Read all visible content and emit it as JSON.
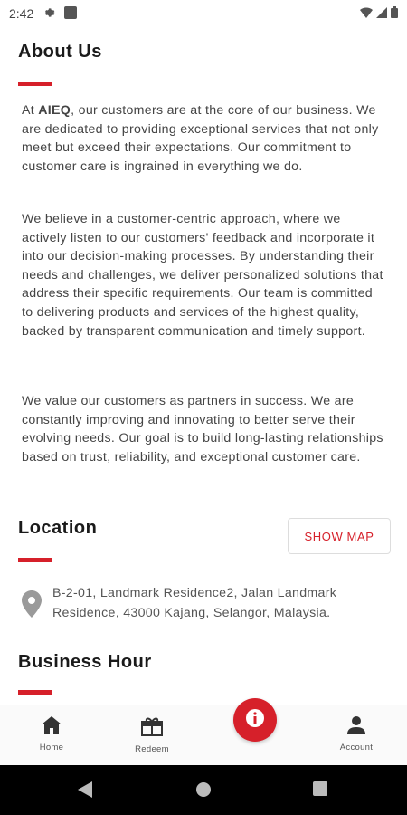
{
  "status_bar": {
    "time": "2:42"
  },
  "about": {
    "title": "About Us",
    "p1_prefix": "At ",
    "p1_brand": "AIEQ",
    "p1_rest": ", our customers are at the core of our business. We are dedicated to providing exceptional services that not only meet but exceed their expectations. Our commitment to customer care is ingrained in everything we do.",
    "p2": "We believe in a customer-centric approach, where we actively listen to our customers' feedback and incorporate it into our decision-making processes. By understanding their needs and challenges, we deliver personalized solutions that address their specific requirements. Our team is committed to delivering products and services of the highest quality, backed by transparent communication and timely support.",
    "p3": "We value our customers as partners in success. We are constantly improving and innovating to better serve their evolving needs. Our goal is to build long-lasting relationships based on trust, reliability, and exceptional customer care."
  },
  "location": {
    "title": "Location",
    "show_map_label": "SHOW MAP",
    "address": "B-2-01, Landmark Residence2, Jalan Landmark Residence, 43000 Kajang, Selangor, Malaysia."
  },
  "business_hour": {
    "title": "Business Hour"
  },
  "bottom_nav": {
    "home_label": "Home",
    "redeem_label": "Redeem",
    "account_label": "Account"
  },
  "colors": {
    "accent": "#d6202a"
  },
  "icons": [
    "gear-icon",
    "app-icon",
    "wifi-icon",
    "signal-icon",
    "battery-icon",
    "location-pin-icon",
    "home-icon",
    "redeem-icon",
    "info-icon",
    "account-icon",
    "back-icon",
    "home-circle-icon",
    "recents-icon"
  ]
}
